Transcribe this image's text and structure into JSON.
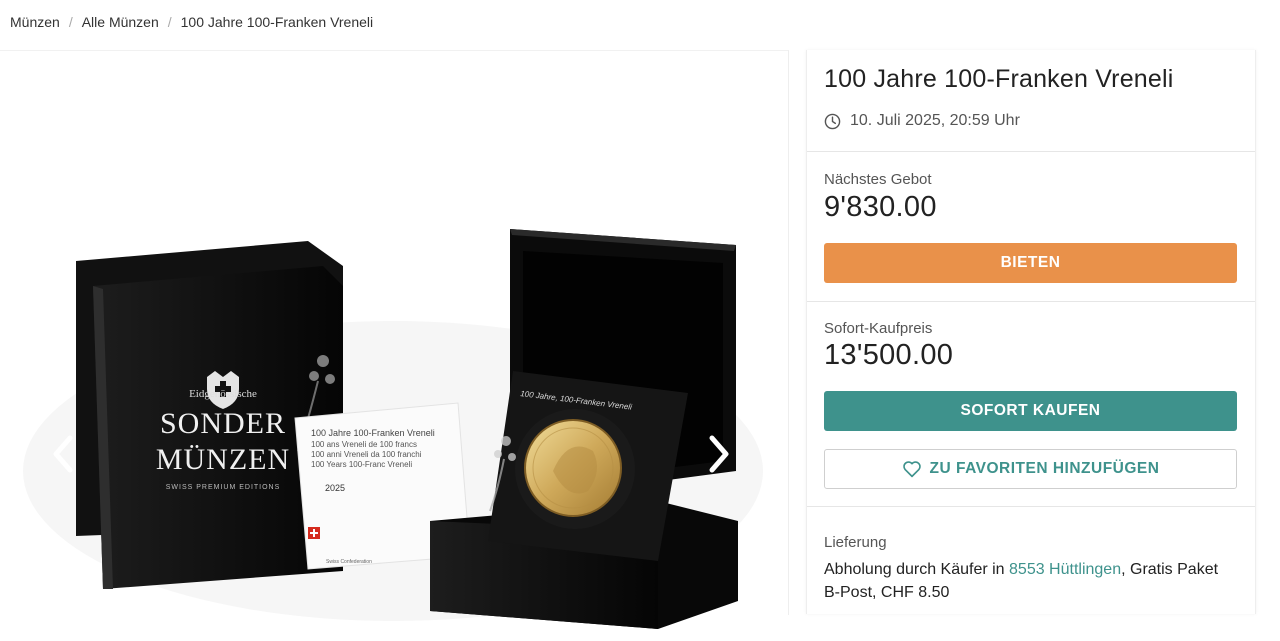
{
  "breadcrumb": {
    "items": [
      "Münzen",
      "Alle Münzen",
      "100 Jahre 100-Franken Vreneli"
    ],
    "separator": "/"
  },
  "product": {
    "title": "100 Jahre 100-Franken Vreneli",
    "end_date": "10. Juli 2025, 20:59 Uhr"
  },
  "image": {
    "box_lid_text_1": "Eidgenössische",
    "box_lid_text_2": "SONDER",
    "box_lid_text_3": "MÜNZEN",
    "box_lid_text_4": "SWISS PREMIUM EDITIONS",
    "card_lines": [
      "100 Jahre 100-Franken Vreneli",
      "100 ans Vreneli de 100 francs",
      "100 anni Vreneli da 100 franchi",
      "100 Years 100-Franc Vreneli"
    ],
    "card_year": "2025",
    "card_footer": "Swiss Confederation",
    "insert_text": "100 Jahre, 100-Franken Vreneli"
  },
  "bidding": {
    "next_bid_label": "Nächstes Gebot",
    "next_bid_value": "9'830.00",
    "bid_button": "BIETEN"
  },
  "buy_now": {
    "label": "Sofort-Kaufpreis",
    "value": "13'500.00",
    "button": "SOFORT KAUFEN"
  },
  "favorites": {
    "button": "ZU FAVORITEN HINZUFÜGEN"
  },
  "delivery": {
    "label": "Lieferung",
    "text_before": "Abholung durch Käufer in ",
    "location_link": "8553 Hüttlingen",
    "text_after": ", Gratis Paket B-Post, CHF 8.50"
  },
  "colors": {
    "accent_orange": "#e9914a",
    "accent_teal": "#3e928c"
  },
  "icons": {
    "clock": "clock-icon",
    "heart": "heart-outline-icon",
    "prev": "chevron-left-icon",
    "next": "chevron-right-icon"
  }
}
